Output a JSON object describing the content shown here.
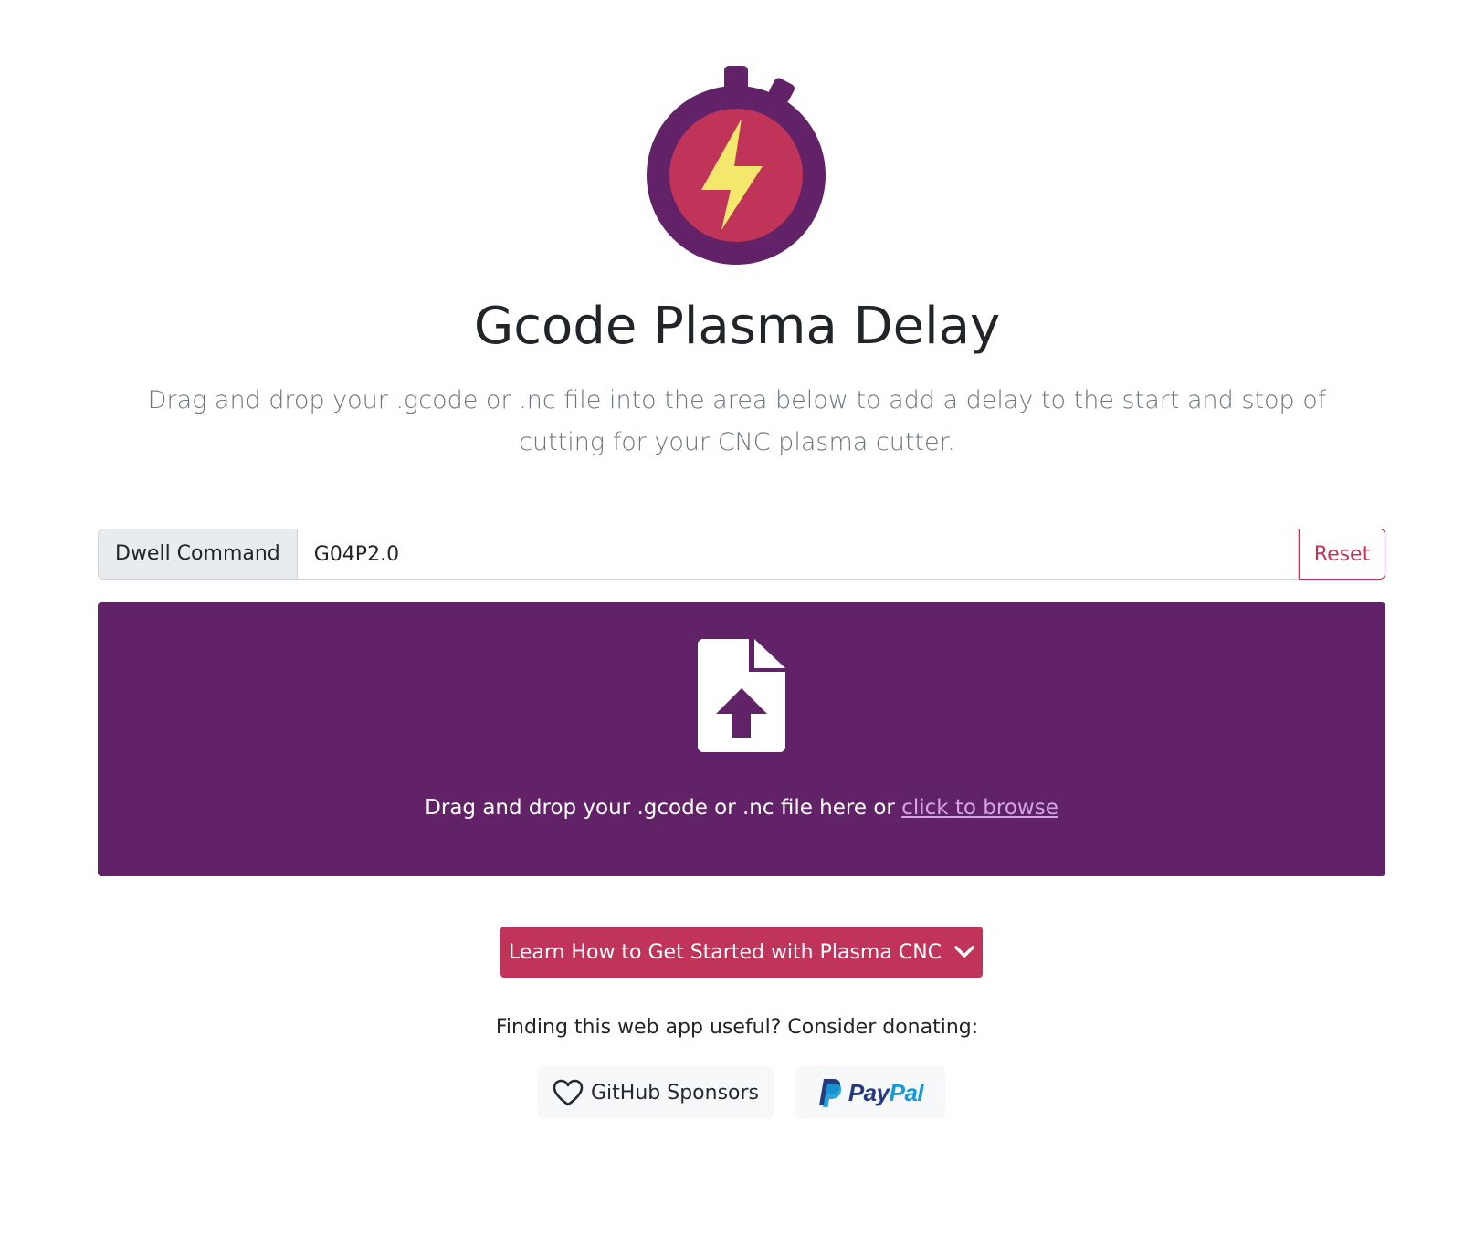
{
  "header": {
    "logo_icon": "stopwatch-lightning-icon",
    "title": "Gcode Plasma Delay",
    "lead": "Drag and drop your .gcode or .nc file into the area below to add a delay to the start and stop of cutting for your CNC plasma cutter."
  },
  "dwell": {
    "label": "Dwell Command",
    "value": "G04P2.0",
    "reset_label": "Reset"
  },
  "dropzone": {
    "icon": "file-upload-icon",
    "text": "Drag and drop your .gcode or .nc file here or",
    "link_text": "click to browse"
  },
  "cta": {
    "label": "Learn How to Get Started with Plasma CNC",
    "icon": "chevron-down-icon"
  },
  "donate": {
    "text": "Finding this web app useful? Consider donating:",
    "github_label": "GitHub Sponsors",
    "github_icon": "heart-icon",
    "paypal_label_a": "Pay",
    "paypal_label_b": "Pal",
    "paypal_icon": "paypal-logo-icon"
  },
  "colors": {
    "primary": "#612268",
    "accent": "#c0345a",
    "logo_outer": "#612268",
    "logo_inner": "#c0345a",
    "bolt": "#f3e86c"
  }
}
